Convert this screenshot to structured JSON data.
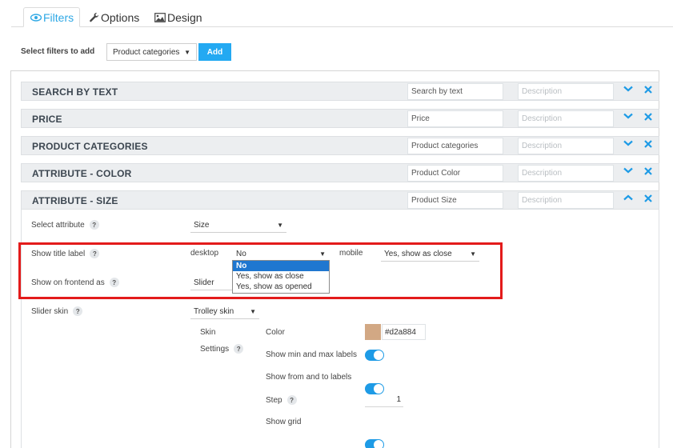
{
  "tabs": [
    {
      "label": "Filters",
      "icon": "eye-icon",
      "active": true
    },
    {
      "label": "Options",
      "icon": "wrench-icon",
      "active": false
    },
    {
      "label": "Design",
      "icon": "image-icon",
      "active": false
    }
  ],
  "add_filter": {
    "label": "Select filters to add",
    "selected": "Product categories",
    "button": "Add"
  },
  "filters": [
    {
      "name": "SEARCH BY TEXT",
      "title_value": "Search by text",
      "description_placeholder": "Description",
      "expanded": false
    },
    {
      "name": "PRICE",
      "title_value": "Price",
      "description_placeholder": "Description",
      "expanded": false
    },
    {
      "name": "PRODUCT CATEGORIES",
      "title_value": "Product categories",
      "description_placeholder": "Description",
      "expanded": false
    },
    {
      "name": "ATTRIBUTE - COLOR",
      "title_value": "Product Color",
      "description_placeholder": "Description",
      "expanded": false
    },
    {
      "name": "ATTRIBUTE - SIZE",
      "title_value": "Product Size",
      "description_placeholder": "Description",
      "expanded": true
    }
  ],
  "settings": {
    "select_attribute": {
      "label": "Select attribute",
      "value": "Size"
    },
    "show_title_label": {
      "label": "Show title label",
      "desktop_label": "desktop",
      "desktop_value": "No",
      "mobile_label": "mobile",
      "mobile_value": "Yes, show as close",
      "dropdown_options": [
        "No",
        "Yes, show as close",
        "Yes, show as opened"
      ],
      "dropdown_selected_index": 0
    },
    "show_on_frontend": {
      "label": "Show on frontend as",
      "value": "Slider"
    },
    "slider_skin": {
      "label": "Slider skin",
      "value": "Trolley skin"
    },
    "skin_settings": {
      "label_line1": "Skin",
      "label_line2": "Settings",
      "color_label": "Color",
      "color_value": "#d2a884",
      "show_min_max_label": "Show min and max labels",
      "show_min_max": true,
      "show_from_to_label": "Show from and to labels",
      "show_from_to": true,
      "step_label": "Step",
      "step_value": "1",
      "show_grid_label": "Show grid",
      "show_grid": true
    }
  },
  "colors": {
    "accent": "#23a9f2",
    "highlight_border": "#e31b1b",
    "dropdown_selected": "#1f77d0",
    "toggle_on": "#1e9be6",
    "skin_swatch": "#d2a884"
  }
}
